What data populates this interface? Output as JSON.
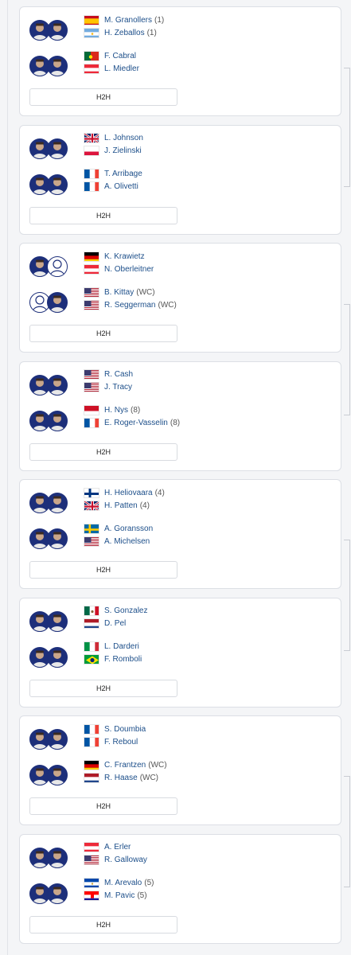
{
  "matches": [
    {
      "team1": [
        {
          "name": "M. Granollers",
          "seed": "(1)",
          "flag": "ESP"
        },
        {
          "name": "H. Zeballos",
          "seed": "(1)",
          "flag": "ARG"
        }
      ],
      "team2": [
        {
          "name": "F. Cabral",
          "seed": "",
          "flag": "POR"
        },
        {
          "name": "L. Miedler",
          "seed": "",
          "flag": "AUT"
        }
      ],
      "h2h": "H2H"
    },
    {
      "team1": [
        {
          "name": "L. Johnson",
          "seed": "",
          "flag": "GBR"
        },
        {
          "name": "J. Zielinski",
          "seed": "",
          "flag": "POL"
        }
      ],
      "team2": [
        {
          "name": "T. Arribage",
          "seed": "",
          "flag": "FRA"
        },
        {
          "name": "A. Olivetti",
          "seed": "",
          "flag": "FRA"
        }
      ],
      "h2h": "H2H"
    },
    {
      "team1": [
        {
          "name": "K. Krawietz",
          "seed": "",
          "flag": "GER"
        },
        {
          "name": "N. Oberleitner",
          "seed": "",
          "flag": "AUT"
        }
      ],
      "team2": [
        {
          "name": "B. Kittay",
          "seed": "(WC)",
          "flag": "USA"
        },
        {
          "name": "R. Seggerman",
          "seed": "(WC)",
          "flag": "USA"
        }
      ],
      "h2h": "H2H"
    },
    {
      "team1": [
        {
          "name": "R. Cash",
          "seed": "",
          "flag": "USA"
        },
        {
          "name": "J. Tracy",
          "seed": "",
          "flag": "USA"
        }
      ],
      "team2": [
        {
          "name": "H. Nys",
          "seed": "(8)",
          "flag": "MON"
        },
        {
          "name": "E. Roger-Vasselin",
          "seed": "(8)",
          "flag": "FRA"
        }
      ],
      "h2h": "H2H"
    },
    {
      "team1": [
        {
          "name": "H. Heliovaara",
          "seed": "(4)",
          "flag": "FIN"
        },
        {
          "name": "H. Patten",
          "seed": "(4)",
          "flag": "GBR"
        }
      ],
      "team2": [
        {
          "name": "A. Goransson",
          "seed": "",
          "flag": "SWE"
        },
        {
          "name": "A. Michelsen",
          "seed": "",
          "flag": "USA"
        }
      ],
      "h2h": "H2H"
    },
    {
      "team1": [
        {
          "name": "S. Gonzalez",
          "seed": "",
          "flag": "MEX"
        },
        {
          "name": "D. Pel",
          "seed": "",
          "flag": "NED"
        }
      ],
      "team2": [
        {
          "name": "L. Darderi",
          "seed": "",
          "flag": "ITA"
        },
        {
          "name": "F. Romboli",
          "seed": "",
          "flag": "BRA"
        }
      ],
      "h2h": "H2H"
    },
    {
      "team1": [
        {
          "name": "S. Doumbia",
          "seed": "",
          "flag": "FRA"
        },
        {
          "name": "F. Reboul",
          "seed": "",
          "flag": "FRA"
        }
      ],
      "team2": [
        {
          "name": "C. Frantzen",
          "seed": "(WC)",
          "flag": "GER"
        },
        {
          "name": "R. Haase",
          "seed": "(WC)",
          "flag": "NED"
        }
      ],
      "h2h": "H2H"
    },
    {
      "team1": [
        {
          "name": "A. Erler",
          "seed": "",
          "flag": "AUT"
        },
        {
          "name": "R. Galloway",
          "seed": "",
          "flag": "USA"
        }
      ],
      "team2": [
        {
          "name": "M. Arevalo",
          "seed": "(5)",
          "flag": "ESA"
        },
        {
          "name": "M. Pavic",
          "seed": "(5)",
          "flag": "CRO"
        }
      ],
      "h2h": "H2H"
    }
  ],
  "colors": {
    "link": "#1d4f8a",
    "avatar_bg": "#1d2f7a"
  }
}
